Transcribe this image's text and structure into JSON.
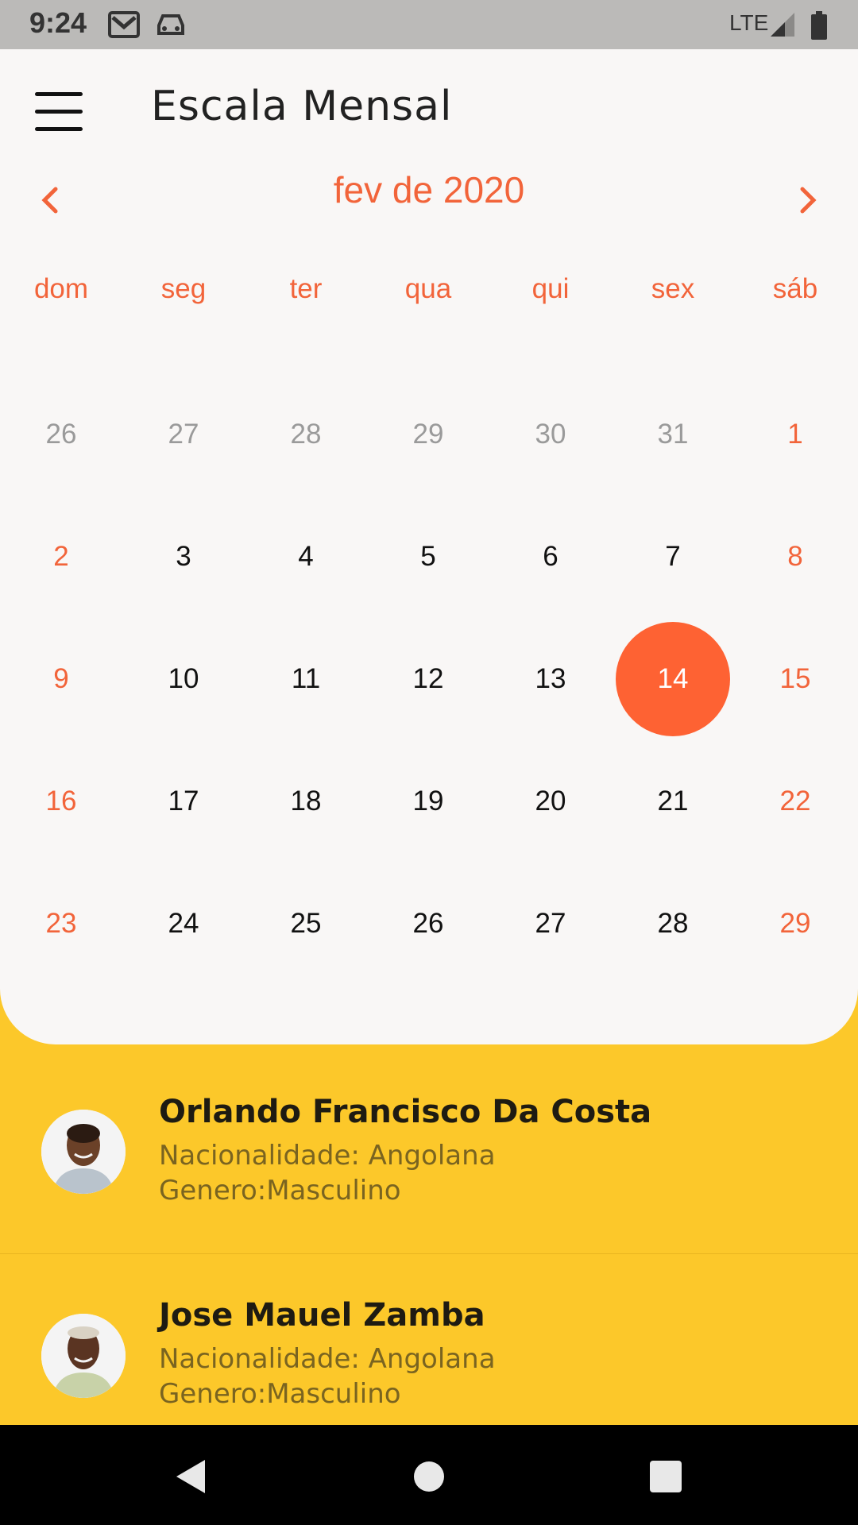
{
  "status_bar": {
    "time": "9:24",
    "network": "LTE",
    "icons": [
      "gmail-icon",
      "car-icon",
      "signal-icon",
      "battery-icon"
    ]
  },
  "app_bar": {
    "title": "Escala Mensal",
    "menu_icon": "hamburger-menu-icon"
  },
  "calendar": {
    "month_label": "fev de 2020",
    "prev_icon": "chevron-left-icon",
    "next_icon": "chevron-right-icon",
    "weekdays": [
      "dom",
      "seg",
      "ter",
      "qua",
      "qui",
      "sex",
      "sáb"
    ],
    "weeks": [
      [
        "26",
        "27",
        "28",
        "29",
        "30",
        "31",
        "1"
      ],
      [
        "2",
        "3",
        "4",
        "5",
        "6",
        "7",
        "8"
      ],
      [
        "9",
        "10",
        "11",
        "12",
        "13",
        "14",
        "15"
      ],
      [
        "16",
        "17",
        "18",
        "19",
        "20",
        "21",
        "22"
      ],
      [
        "23",
        "24",
        "25",
        "26",
        "27",
        "28",
        "29"
      ]
    ],
    "selected_day": "14",
    "accent_color": "#f2643a",
    "selected_color": "#fe6233"
  },
  "people": [
    {
      "name": "Orlando Francisco Da Costa",
      "nationality": "Nacionalidade: Angolana",
      "gender": "Genero:Masculino"
    },
    {
      "name": "Jose Mauel Zamba",
      "nationality": "Nacionalidade: Angolana",
      "gender": "Genero:Masculino"
    }
  ],
  "list_background": "#fcc82a",
  "nav_bar": {
    "icons": [
      "back-icon",
      "home-icon",
      "recents-icon"
    ]
  }
}
